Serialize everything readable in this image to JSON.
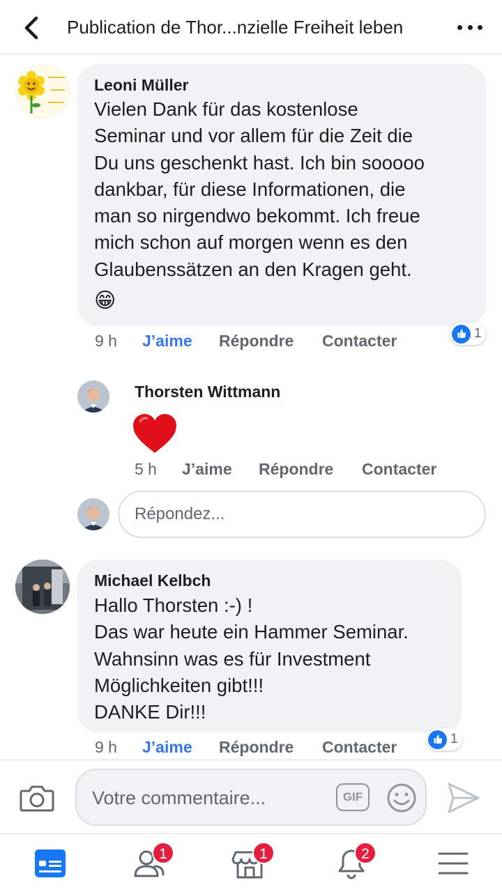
{
  "header": {
    "title": "Publication de Thor...nzielle Freiheit leben"
  },
  "comments": [
    {
      "author": "Leoni Müller",
      "lines": [
        "Vielen Dank für das kostenlose",
        "Seminar und vor allem für die Zeit die",
        "Du uns geschenkt hast. Ich bin sooooo",
        "dankbar, für diese Informationen, die",
        "man so nirgendwo bekommt. Ich freue",
        "mich schon auf morgen wenn es den",
        "Glaubenssätzen an den Kragen geht."
      ],
      "emoji": "😁",
      "time": "9 h",
      "like_label": "J’aime",
      "reply_label": "Répondre",
      "contact_label": "Contacter",
      "reaction_count": "1"
    },
    {
      "author": "Michael Kelbch",
      "lines": [
        "Hallo Thorsten :-) !",
        "Das war heute ein Hammer Seminar.",
        "Wahnsinn was es für Investment",
        "Möglichkeiten gibt!!!",
        "DANKE Dir!!!"
      ],
      "time": "9 h",
      "like_label": "J’aime",
      "reply_label": "Répondre",
      "contact_label": "Contacter",
      "reaction_count": "1"
    }
  ],
  "reply": {
    "author": "Thorsten Wittmann",
    "content": "heart",
    "time": "5 h",
    "like_label": "J’aime",
    "reply_label": "Répondre",
    "contact_label": "Contacter"
  },
  "reply_input": {
    "placeholder": "Répondez..."
  },
  "composer": {
    "placeholder": "Votre commentaire...",
    "gif_label": "GIF"
  },
  "tabbar": {
    "tabs": [
      {
        "icon": "news-feed-icon",
        "badge": ""
      },
      {
        "icon": "friends-icon",
        "badge": "1"
      },
      {
        "icon": "marketplace-icon",
        "badge": "1"
      },
      {
        "icon": "notifications-bell-icon",
        "badge": "2"
      },
      {
        "icon": "menu-icon",
        "badge": ""
      }
    ]
  },
  "colors": {
    "accent": "#3578e5",
    "bubble": "#f0f2f5",
    "badge": "#e41e3f",
    "heart": "#e0101a"
  }
}
